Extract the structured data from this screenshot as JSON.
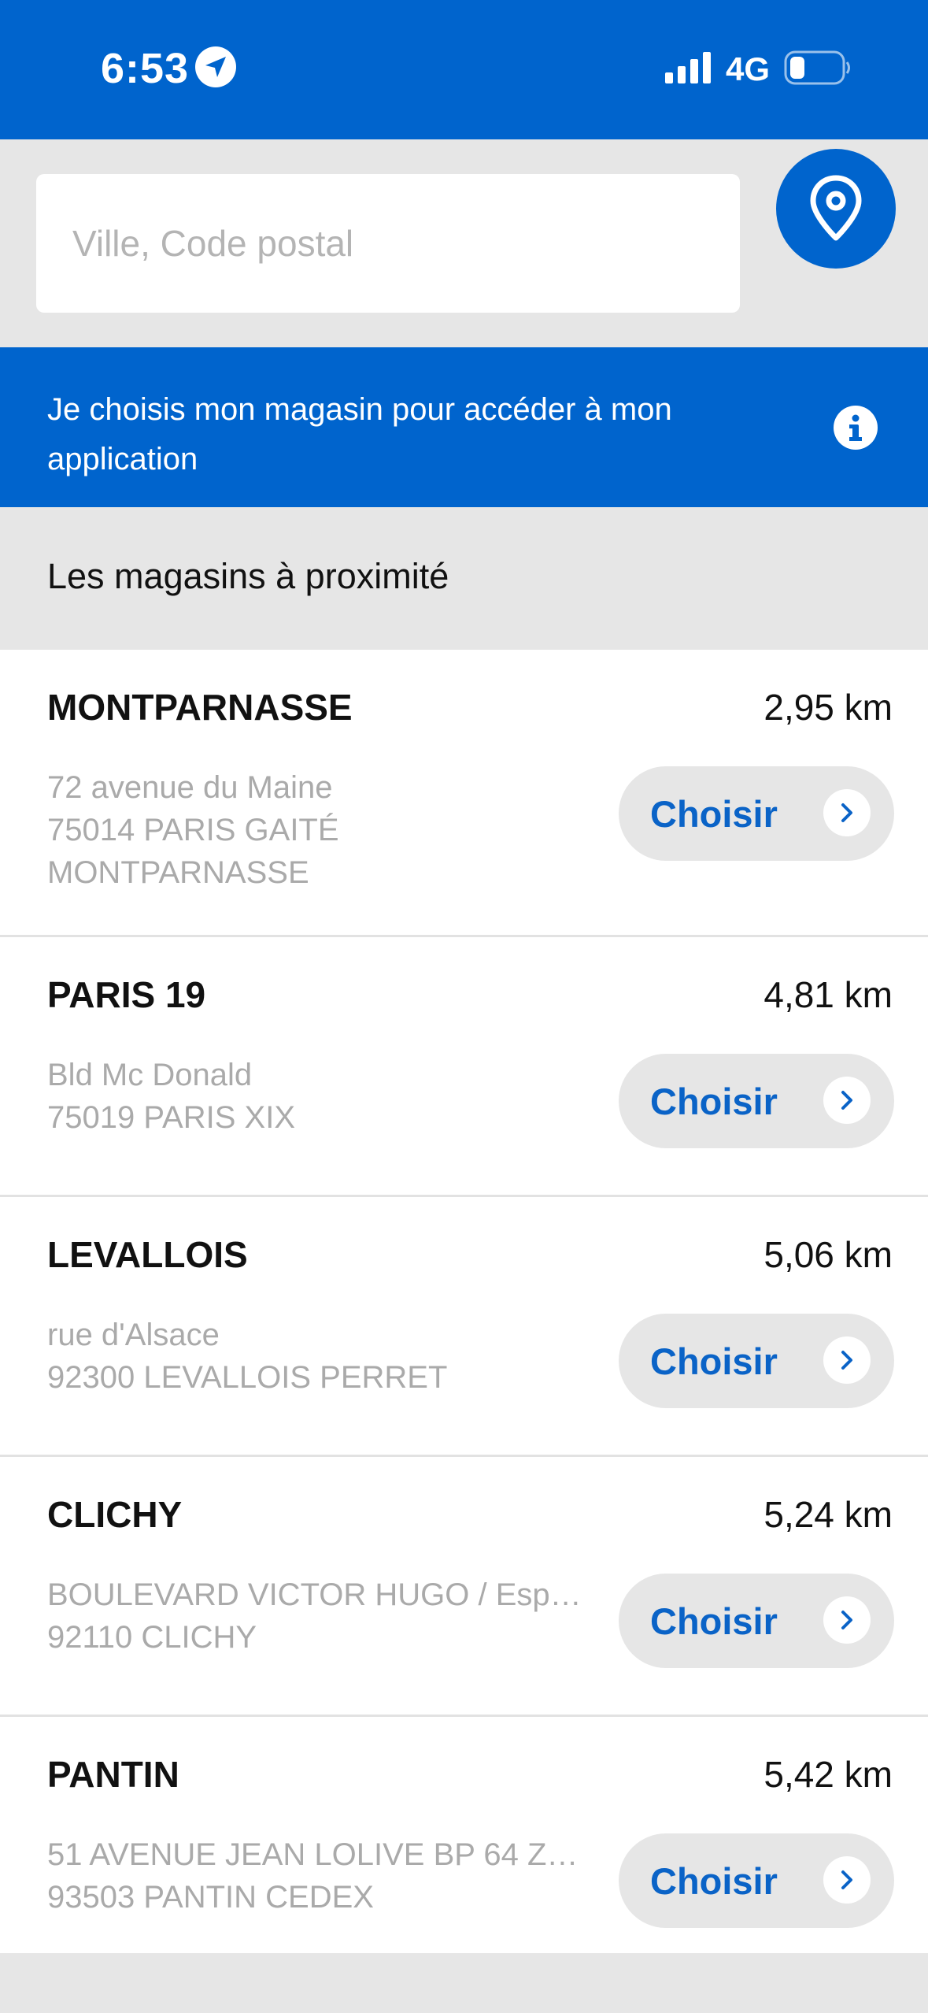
{
  "status_bar": {
    "time": "6:53",
    "network": "4G",
    "icons": [
      "location-arrow-icon",
      "signal-icon",
      "battery-icon"
    ]
  },
  "search": {
    "placeholder": "Ville, Code postal",
    "value": "",
    "locate_icon": "map-pin-icon"
  },
  "info_banner": {
    "text": "Je choisis mon magasin pour accéder à mon application",
    "icon": "info-icon"
  },
  "section": {
    "title": "Les magasins à proximité"
  },
  "stores": [
    {
      "name": "MONTPARNASSE",
      "distance": "2,95 km",
      "address_lines": [
        "72 avenue du Maine",
        "75014 PARIS GAITÉ",
        "MONTPARNASSE"
      ],
      "button_label": "Choisir"
    },
    {
      "name": "PARIS 19",
      "distance": "4,81 km",
      "address_lines": [
        "Bld Mc Donald",
        "75019 PARIS XIX"
      ],
      "button_label": "Choisir"
    },
    {
      "name": "LEVALLOIS",
      "distance": "5,06 km",
      "address_lines": [
        "rue d'Alsace",
        "92300 LEVALLOIS PERRET"
      ],
      "button_label": "Choisir"
    },
    {
      "name": "CLICHY",
      "distance": "5,24 km",
      "address_lines": [
        "BOULEVARD VICTOR HUGO / Espa…",
        "92110 CLICHY"
      ],
      "button_label": "Choisir"
    },
    {
      "name": "PANTIN",
      "distance": "5,42 km",
      "address_lines": [
        "51 AVENUE JEAN LOLIVE BP 64 Z…",
        "93503 PANTIN CEDEX"
      ],
      "button_label": "Choisir"
    }
  ],
  "colors": {
    "brand_blue": "#0064cd",
    "button_text_blue": "#0a63c7",
    "background_gray": "#e6e6e6"
  }
}
